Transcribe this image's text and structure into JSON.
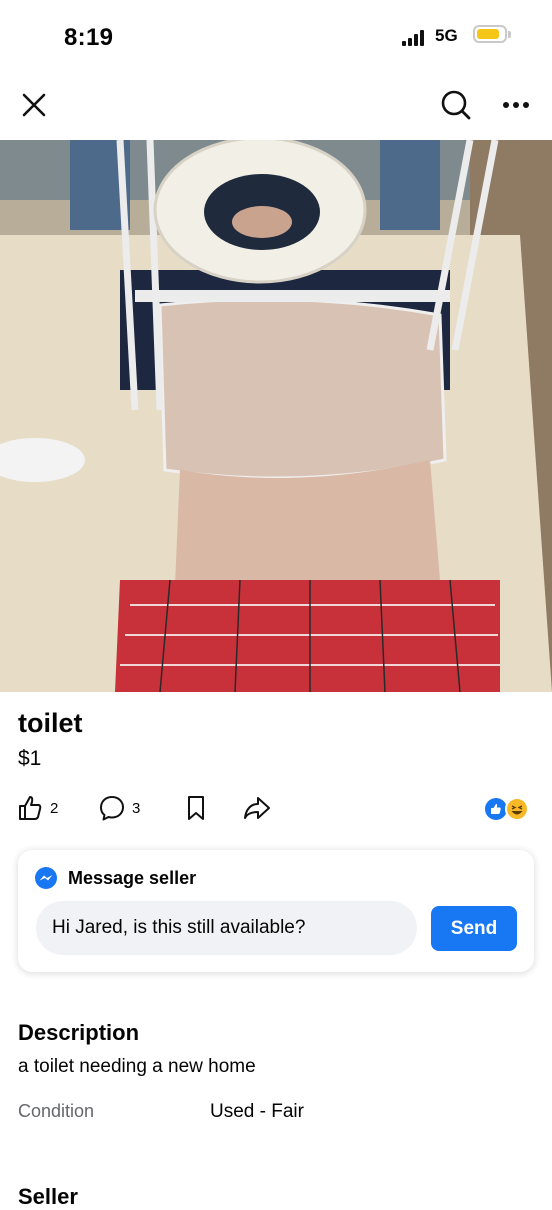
{
  "status_bar": {
    "time": "8:19",
    "network": "5G",
    "battery_level": 0.65,
    "battery_color": "#f5c518"
  },
  "top_bar": {
    "close_icon": "close-icon",
    "search_icon": "search-icon",
    "more_icon": "more-dots-icon"
  },
  "listing": {
    "title": "toilet",
    "price": "$1",
    "actions": {
      "likes": "2",
      "comments": "3",
      "save_icon": "bookmark-icon",
      "share_icon": "share-icon",
      "reaction_icons": [
        "like-reaction-icon",
        "haha-reaction-icon"
      ]
    },
    "message_seller": {
      "title": "Message seller",
      "input_value": "Hi Jared, is this still available?",
      "send_label": "Send"
    },
    "description": {
      "heading": "Description",
      "text": "a toilet needing a new home"
    },
    "details": {
      "condition_label": "Condition",
      "condition_value": "Used - Fair"
    },
    "seller_heading": "Seller",
    "accent_color": "#1877f2"
  }
}
